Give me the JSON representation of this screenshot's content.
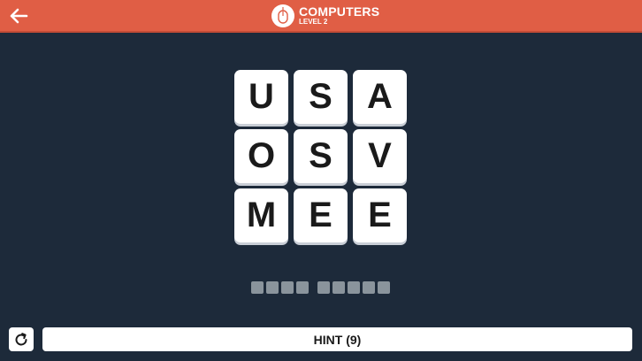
{
  "header": {
    "category": "COMPUTERS",
    "level": "LEVEL 2",
    "back_icon": "arrow-left-icon",
    "category_icon": "computer-mouse-icon",
    "bar_color": "#e05e45"
  },
  "board": {
    "rows": [
      [
        "U",
        "S",
        "A"
      ],
      [
        "O",
        "S",
        "V"
      ],
      [
        "M",
        "E",
        "E"
      ]
    ]
  },
  "answer": {
    "words": [
      4,
      5
    ]
  },
  "footer": {
    "refresh_icon": "refresh-icon",
    "hint_label": "HINT (9)"
  },
  "colors": {
    "background": "#1d2a3a",
    "tile": "#ffffff",
    "slot": "#8a949c"
  }
}
